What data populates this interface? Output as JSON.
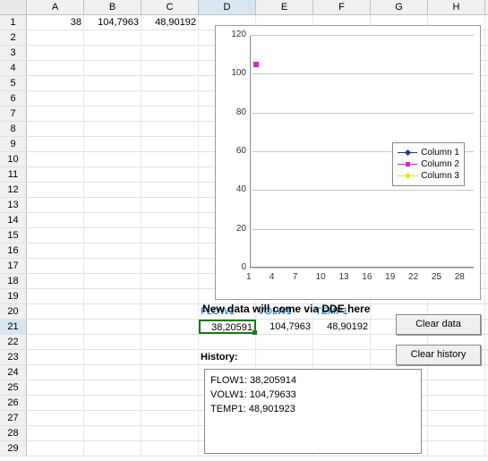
{
  "columns": [
    "A",
    "B",
    "C",
    "D",
    "E",
    "F",
    "G",
    "H"
  ],
  "selected_col": "D",
  "selected_row": 21,
  "cells": {
    "A1": "38",
    "B1": "104,7963",
    "C1": "48,90192",
    "D19_label": "New data will come via DDE here",
    "D20": "FLOW1",
    "E20": "VOLW1",
    "F20": "TEMP1",
    "D21": "38,20591",
    "E21": "104,7963",
    "F21": "48,90192",
    "D23": "History:"
  },
  "buttons": {
    "clear_data": "Clear data",
    "clear_history": "Clear history"
  },
  "history": {
    "l1": "FLOW1: 38,205914",
    "l2": "VOLW1: 104,79633",
    "l3": "TEMP1: 48,901923"
  },
  "chart_data": {
    "type": "line",
    "x": [
      1,
      4,
      7,
      10,
      13,
      16,
      19,
      22,
      25,
      28
    ],
    "y_ticks": [
      0,
      20,
      40,
      60,
      80,
      100,
      120
    ],
    "series": [
      {
        "name": "Column 1",
        "color": "#1a3a8a",
        "values": []
      },
      {
        "name": "Column 2",
        "color": "#e020c0",
        "values": [
          105
        ]
      },
      {
        "name": "Column 3",
        "color": "#e6e600",
        "values": []
      }
    ],
    "ylim": [
      0,
      120
    ],
    "xlim": [
      1,
      30
    ]
  }
}
